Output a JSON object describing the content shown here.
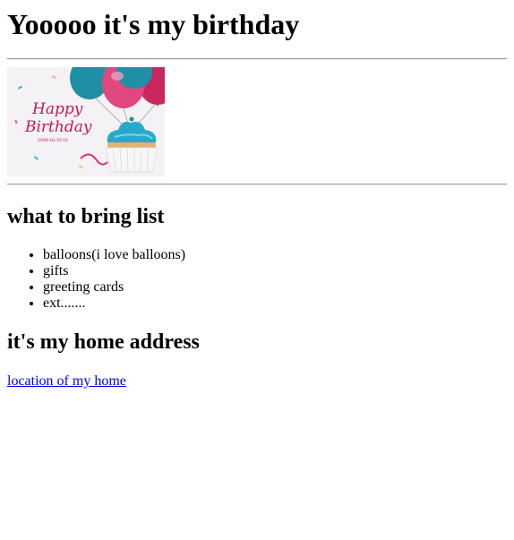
{
  "page": {
    "title": "Yooooo it's my birthday"
  },
  "banner": {
    "text_line1": "Happy",
    "text_line2": "Birthday",
    "text_small": "FROM ALL OF US",
    "colors": {
      "balloon_pink": "#d6336c",
      "balloon_teal": "#1f9fb5",
      "frosting": "#29a9c9",
      "text": "#c2185b"
    }
  },
  "bring_section": {
    "heading": "what to bring list",
    "items": [
      "balloons(i love balloons)",
      "gifts",
      "greeting cards",
      "ext......."
    ]
  },
  "address_section": {
    "heading": "it's my home address",
    "link_text": "location of my home",
    "link_color": "#0000ee"
  }
}
